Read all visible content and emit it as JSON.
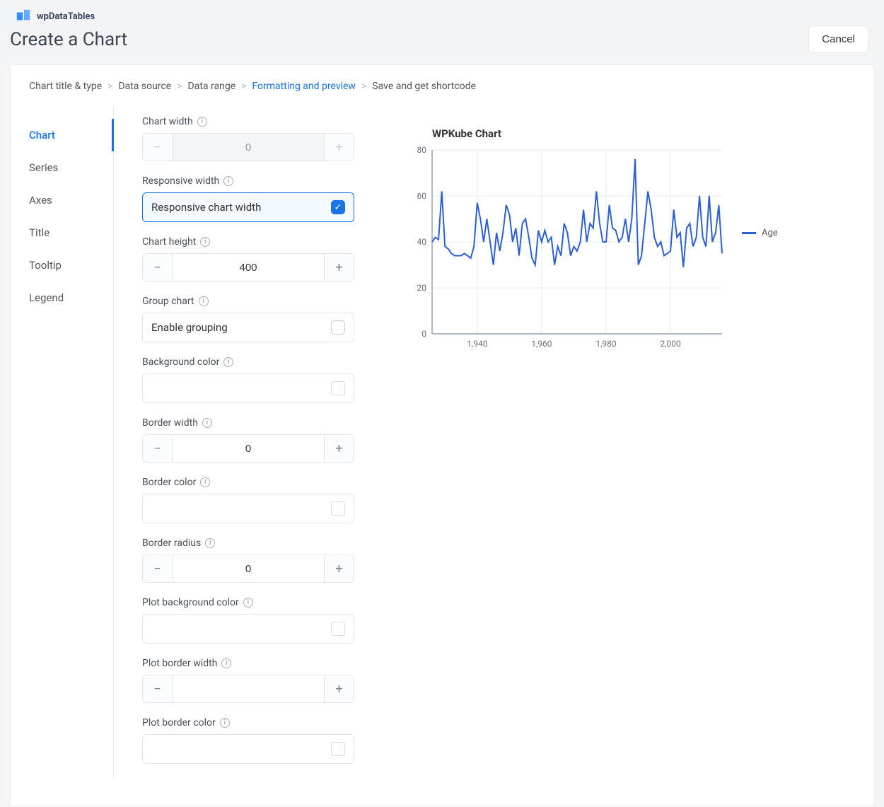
{
  "brand": {
    "name": "wpDataTables"
  },
  "page": {
    "title": "Create a Chart",
    "cancel": "Cancel"
  },
  "breadcrumb": {
    "step1": "Chart title & type",
    "step2": "Data source",
    "step3": "Data range",
    "step4": "Formatting and preview",
    "step5": "Save and get shortcode"
  },
  "tabs": {
    "chart": "Chart",
    "series": "Series",
    "axes": "Axes",
    "title": "Title",
    "tooltip": "Tooltip",
    "legend": "Legend"
  },
  "form": {
    "chart_width": {
      "label": "Chart width",
      "value": "0"
    },
    "responsive_width": {
      "label": "Responsive width",
      "option": "Responsive chart width",
      "checked": true
    },
    "chart_height": {
      "label": "Chart height",
      "value": "400"
    },
    "group_chart": {
      "label": "Group chart",
      "option": "Enable grouping",
      "checked": false
    },
    "background_color": {
      "label": "Background color"
    },
    "border_width": {
      "label": "Border width",
      "value": "0"
    },
    "border_color": {
      "label": "Border color"
    },
    "border_radius": {
      "label": "Border radius",
      "value": "0"
    },
    "plot_bg_color": {
      "label": "Plot background color"
    },
    "plot_border_width": {
      "label": "Plot border width",
      "value": ""
    },
    "plot_border_color": {
      "label": "Plot border color"
    }
  },
  "preview": {
    "title": "WPKube Chart",
    "legend_label": "Age"
  },
  "chart_data": {
    "type": "line",
    "title": "WPKube Chart",
    "xlabel": "",
    "ylabel": "",
    "ylim": [
      0,
      80
    ],
    "xlim": [
      1926,
      2016
    ],
    "x_ticks": [
      1940,
      1960,
      1980,
      2000
    ],
    "y_ticks": [
      0,
      20,
      40,
      60,
      80
    ],
    "series": [
      {
        "name": "Age",
        "x": [
          1926,
          1927,
          1928,
          1929,
          1930,
          1931,
          1932,
          1933,
          1934,
          1935,
          1936,
          1937,
          1938,
          1939,
          1940,
          1941,
          1942,
          1943,
          1944,
          1945,
          1946,
          1947,
          1948,
          1949,
          1950,
          1951,
          1952,
          1953,
          1954,
          1955,
          1956,
          1957,
          1958,
          1959,
          1960,
          1961,
          1962,
          1963,
          1964,
          1965,
          1966,
          1967,
          1968,
          1969,
          1970,
          1971,
          1972,
          1973,
          1974,
          1975,
          1976,
          1977,
          1978,
          1979,
          1980,
          1981,
          1982,
          1983,
          1984,
          1985,
          1986,
          1987,
          1988,
          1989,
          1990,
          1991,
          1992,
          1993,
          1994,
          1995,
          1996,
          1997,
          1998,
          1999,
          2000,
          2001,
          2002,
          2003,
          2004,
          2005,
          2006,
          2007,
          2008,
          2009,
          2010,
          2011,
          2012,
          2013,
          2014,
          2015,
          2016
        ],
        "values": [
          40,
          42,
          41,
          62,
          38,
          37,
          35,
          34,
          34,
          34,
          35,
          34,
          33,
          38,
          57,
          50,
          40,
          50,
          40,
          30,
          44,
          36,
          44,
          56,
          52,
          40,
          46,
          34,
          48,
          50,
          42,
          33,
          30,
          45,
          40,
          45,
          40,
          42,
          30,
          38,
          34,
          48,
          44,
          34,
          38,
          36,
          40,
          54,
          40,
          48,
          46,
          62,
          48,
          40,
          40,
          56,
          46,
          45,
          40,
          42,
          50,
          40,
          50,
          76,
          30,
          34,
          48,
          62,
          54,
          42,
          38,
          40,
          34,
          35,
          36,
          54,
          42,
          44,
          29,
          46,
          48,
          38,
          42,
          60,
          42,
          38,
          60,
          40,
          44,
          56,
          35
        ]
      }
    ]
  }
}
